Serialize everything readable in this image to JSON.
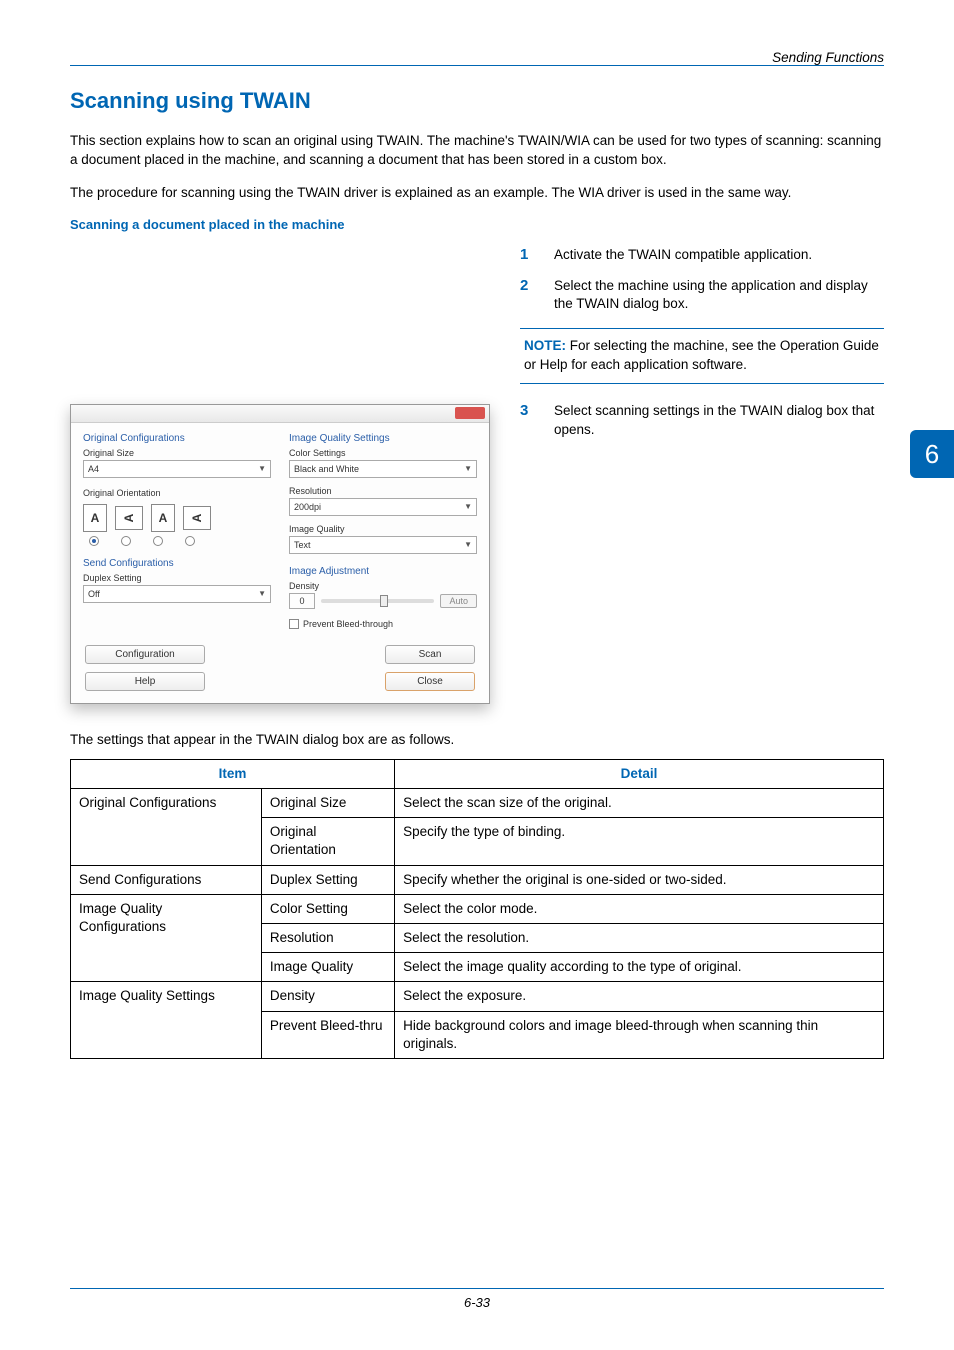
{
  "header": {
    "section": "Sending Functions"
  },
  "page_tab": "6",
  "title": "Scanning using TWAIN",
  "intro_p1": "This section explains how to scan an original using TWAIN. The machine's TWAIN/WIA can be used for two types of scanning: scanning a document placed in the machine, and scanning a document that has been stored in a custom box.",
  "intro_p2": "The procedure for scanning using the TWAIN driver is explained as an example. The WIA driver is used in the same way.",
  "subhead": "Scanning a document placed in the machine",
  "steps": {
    "s1": {
      "num": "1",
      "text": "Activate the TWAIN compatible application."
    },
    "s2": {
      "num": "2",
      "text": "Select the machine using the application and display the TWAIN dialog box."
    },
    "s3": {
      "num": "3",
      "text": "Select scanning settings in the TWAIN dialog box that opens."
    }
  },
  "note": {
    "label": "NOTE:",
    "text": " For selecting the machine, see the Operation Guide or Help for each application software."
  },
  "dialog": {
    "orig_conf": "Original Configurations",
    "orig_size": "Original Size",
    "orig_size_val": "A4",
    "orig_orient": "Original Orientation",
    "send_conf": "Send Configurations",
    "duplex": "Duplex Setting",
    "duplex_val": "Off",
    "iqs": "Image Quality Settings",
    "color": "Color Settings",
    "color_val": "Black and White",
    "res": "Resolution",
    "res_val": "200dpi",
    "iq": "Image Quality",
    "iq_val": "Text",
    "img_adj": "Image Adjustment",
    "density": "Density",
    "density_val": "0",
    "auto": "Auto",
    "prevent": "Prevent Bleed-through",
    "config_btn": "Configuration",
    "help_btn": "Help",
    "scan_btn": "Scan",
    "close_btn": "Close"
  },
  "table_caption": "The settings that appear in the TWAIN dialog box are as follows.",
  "table": {
    "h_item": "Item",
    "h_detail": "Detail",
    "g1": "Original Configurations",
    "g1r1a": "Original Size",
    "g1r1b": "Select the scan size of the original.",
    "g1r2a": "Original Orientation",
    "g1r2b": "Specify the type of binding.",
    "g2": "Send Configurations",
    "g2r1a": "Duplex Setting",
    "g2r1b": "Specify whether the original is one-sided or two-sided.",
    "g3": "Image Quality Configurations",
    "g3r1a": "Color Setting",
    "g3r1b": "Select the color mode.",
    "g3r2a": "Resolution",
    "g3r2b": "Select the resolution.",
    "g3r3a": "Image Quality",
    "g3r3b": "Select the image quality according to the type of original.",
    "g4": "Image Quality Settings",
    "g4r1a": "Density",
    "g4r1b": "Select the exposure.",
    "g4r2a": "Prevent Bleed-thru",
    "g4r2b": "Hide background colors and image bleed-through when scanning thin originals."
  },
  "footer": "6-33"
}
